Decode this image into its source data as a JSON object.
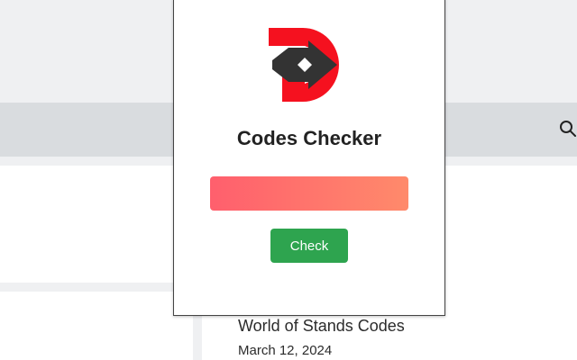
{
  "popup": {
    "title": "Codes Checker",
    "logo_icon": "codes-checker-logo",
    "input_value": "",
    "input_placeholder": "",
    "check_label": "Check",
    "colors": {
      "logo_red": "#f5111f",
      "logo_dark": "#333333",
      "input_gradient_start": "#ff5f6d",
      "input_gradient_end": "#ff8a6b",
      "button_green": "#2ea44f"
    }
  },
  "background_site": {
    "search_icon": "search-icon",
    "post": {
      "title": "World of Stands Codes",
      "date": "March 12, 2024"
    }
  }
}
